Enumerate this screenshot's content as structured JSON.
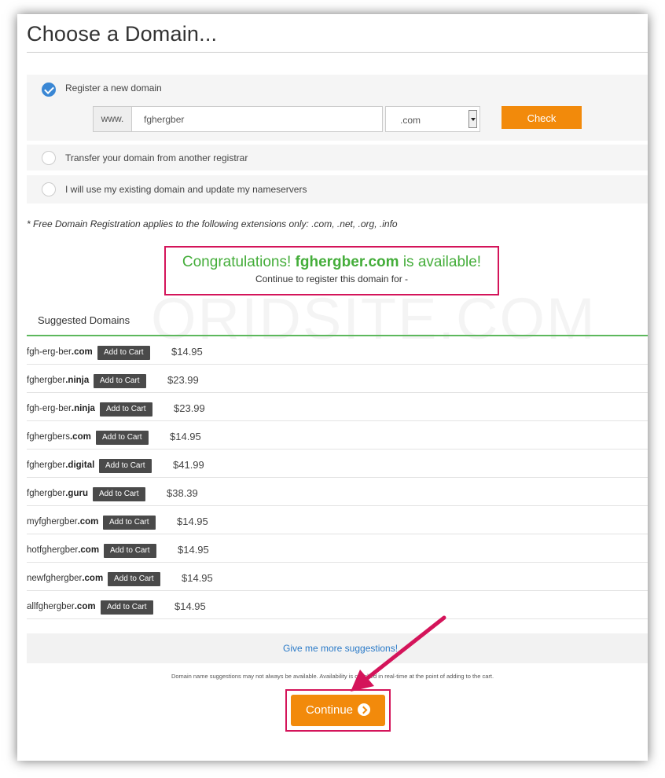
{
  "page": {
    "title": "Choose a Domain..."
  },
  "options": {
    "register_label": "Register a new domain",
    "transfer_label": "Transfer your domain from another registrar",
    "existing_label": "I will use my existing domain and update my nameservers"
  },
  "search": {
    "prefix": "www.",
    "domain_value": "fghergber",
    "tld_value": ".com",
    "check_label": "Check"
  },
  "note": "* Free Domain Registration applies to the following extensions only: .com, .net, .org, .info",
  "availability": {
    "congrats_prefix": "Congratulations!",
    "domain": "fghergber.com",
    "congrats_suffix": "is available!",
    "subtext": "Continue to register this domain for -"
  },
  "watermark": "ORIDSITE.COM",
  "suggestions": {
    "header": "Suggested Domains",
    "add_label": "Add to Cart",
    "items": [
      {
        "name": "fgh-erg-ber",
        "tld": ".com",
        "price": "$14.95"
      },
      {
        "name": "fghergber",
        "tld": ".ninja",
        "price": "$23.99"
      },
      {
        "name": "fgh-erg-ber",
        "tld": ".ninja",
        "price": "$23.99"
      },
      {
        "name": "fghergbers",
        "tld": ".com",
        "price": "$14.95"
      },
      {
        "name": "fghergber",
        "tld": ".digital",
        "price": "$41.99"
      },
      {
        "name": "fghergber",
        "tld": ".guru",
        "price": "$38.39"
      },
      {
        "name": "myfghergber",
        "tld": ".com",
        "price": "$14.95"
      },
      {
        "name": "hotfghergber",
        "tld": ".com",
        "price": "$14.95"
      },
      {
        "name": "newfghergber",
        "tld": ".com",
        "price": "$14.95"
      },
      {
        "name": "allfghergber",
        "tld": ".com",
        "price": "$14.95"
      }
    ]
  },
  "more_suggestions_label": "Give me more suggestions!",
  "disclaimer": "Domain name suggestions may not always be available. Availability is checked in real-time at the point of adding to the cart.",
  "continue_label": "Continue",
  "colors": {
    "accent_orange": "#f28a0b",
    "highlight_border": "#d4145a",
    "success_green": "#44ad3a",
    "link_blue": "#2a7ac8"
  },
  "icons": {
    "checked_radio": "check-icon",
    "continue": "arrow-circle-right-icon",
    "annotation": "red-arrow-icon"
  }
}
